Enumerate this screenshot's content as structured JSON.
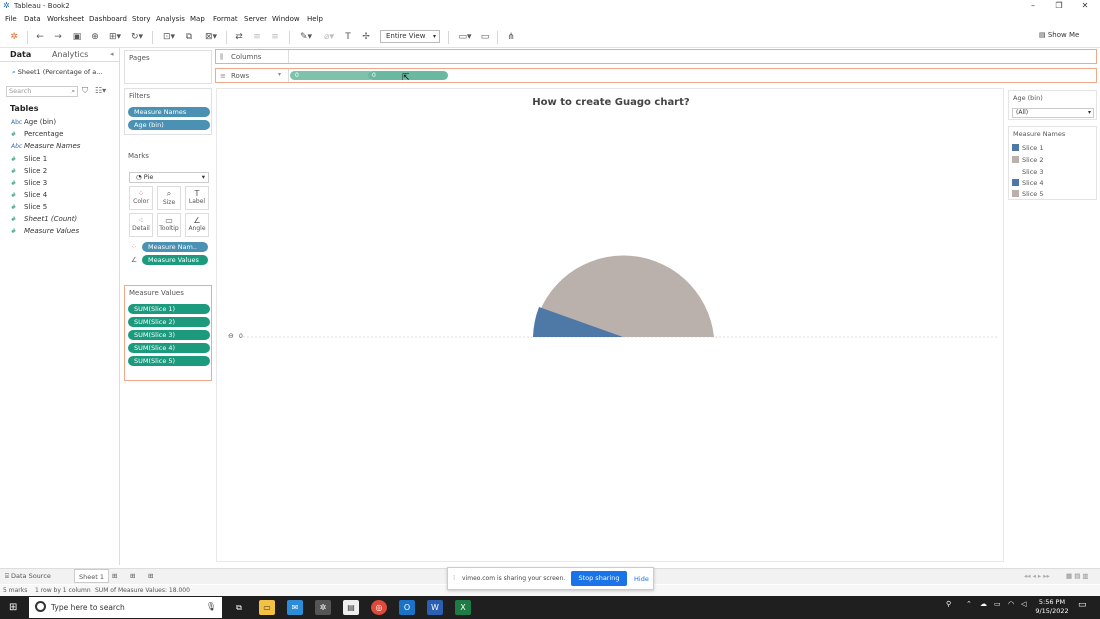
{
  "window": {
    "title": "Tableau - Book2"
  },
  "menu": [
    "File",
    "Data",
    "Worksheet",
    "Dashboard",
    "Story",
    "Analysis",
    "Map",
    "Format",
    "Server",
    "Window",
    "Help"
  ],
  "toolbar": {
    "view_mode": "Entire View",
    "show_me": "Show Me"
  },
  "data_pane": {
    "tab_data": "Data",
    "tab_analytics": "Analytics",
    "datasource": "Sheet1 (Percentage of a...",
    "search_placeholder": "Search",
    "tables_heading": "Tables",
    "fields": [
      {
        "label": "Age (bin)",
        "type": "Abc"
      },
      {
        "label": "Percentage",
        "type": "#"
      },
      {
        "label": "Measure Names",
        "type": "Abc"
      },
      {
        "label": "Slice 1",
        "type": "#"
      },
      {
        "label": "Slice 2",
        "type": "#"
      },
      {
        "label": "Slice 3",
        "type": "#"
      },
      {
        "label": "Slice 4",
        "type": "#"
      },
      {
        "label": "Slice 5",
        "type": "#"
      },
      {
        "label": "Sheet1 (Count)",
        "type": "#"
      },
      {
        "label": "Measure Values",
        "type": "#"
      }
    ]
  },
  "pages": {
    "label": "Pages"
  },
  "filters": {
    "label": "Filters",
    "pills": [
      "Measure Names",
      "Age (bin)"
    ]
  },
  "marks": {
    "label": "Marks",
    "type": "Pie",
    "buttons": [
      "Color",
      "Size",
      "Label",
      "Detail",
      "Tooltip",
      "Angle"
    ],
    "pills": [
      "Measure Nam..",
      "Measure Values"
    ]
  },
  "measure_values": {
    "label": "Measure Values",
    "pills": [
      "SUM(Slice 1)",
      "SUM(Slice 2)",
      "SUM(Slice 3)",
      "SUM(Slice 4)",
      "SUM(Slice 5)"
    ]
  },
  "shelves": {
    "columns_label": "Columns",
    "rows_label": "Rows",
    "rows_pill_value": "0",
    "rows_pill_value2": "0"
  },
  "canvas": {
    "title": "How to create Guago chart?",
    "axis_zero": "0"
  },
  "legend_age": {
    "label": "Age (bin)",
    "value": "(All)"
  },
  "legend_measure": {
    "label": "Measure Names",
    "items": [
      {
        "name": "Slice 1",
        "color": "#4e79a7"
      },
      {
        "name": "Slice 2",
        "color": "#bab0ac"
      },
      {
        "name": "Slice 3",
        "color": "#ffffff"
      },
      {
        "name": "Slice 4",
        "color": "#4e79a7"
      },
      {
        "name": "Slice 5",
        "color": "#bab0ac"
      }
    ]
  },
  "pie": {
    "colors": {
      "blue": "#4e79a7",
      "gray": "#bab0ac"
    }
  },
  "bottom": {
    "data_source": "Data Source",
    "sheet": "Sheet 1"
  },
  "status": {
    "marks": "5 marks",
    "rows": "1 row by 1 column",
    "sum": "SUM of Measure Values: 18.000"
  },
  "share": {
    "message": "vimeo.com is sharing your screen.",
    "stop": "Stop sharing",
    "hide": "Hide"
  },
  "taskbar": {
    "search": "Type here to search",
    "time": "5:56 PM",
    "date": "9/15/2022"
  }
}
